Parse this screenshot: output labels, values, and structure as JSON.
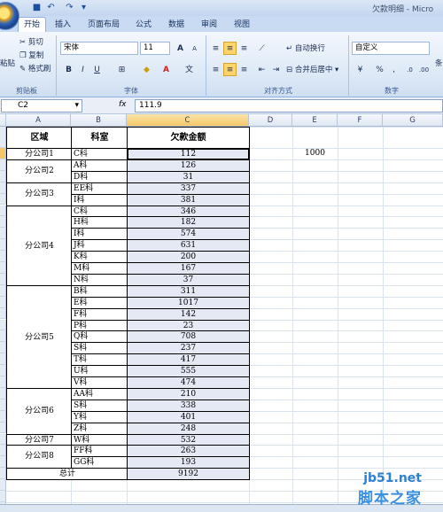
{
  "window": {
    "title": "欠款明细 - Micro"
  },
  "tabs": [
    "开始",
    "插入",
    "页面布局",
    "公式",
    "数据",
    "审阅",
    "视图"
  ],
  "ribbon": {
    "clipboard": {
      "paste": "粘贴",
      "cut": "剪切",
      "copy": "复制",
      "format_painter": "格式刷",
      "label": "剪贴板"
    },
    "font": {
      "name": "宋体",
      "size": "11",
      "grow": "A",
      "shrink": "A",
      "bold": "B",
      "italic": "I",
      "underline": "U",
      "label": "字体"
    },
    "alignment": {
      "wrap_text": "自动换行",
      "merge_center": "合并后居中",
      "label": "对齐方式"
    },
    "number": {
      "format": "自定义",
      "percent": "%",
      "comma": ",",
      "inc_dec": ".0",
      "dec_dec": ".00",
      "label": "数字"
    },
    "cut_off": "条"
  },
  "formula_bar": {
    "name_box": "C2",
    "fx": "fx",
    "formula": "111.9"
  },
  "columns": [
    "A",
    "B",
    "C",
    "D",
    "E",
    "F",
    "G"
  ],
  "table": {
    "headers": {
      "region": "区域",
      "dept": "科室",
      "amount": "欠款金额"
    },
    "groups": [
      {
        "region": "分公司1",
        "rows": [
          {
            "dept": "C科",
            "amount": "112"
          }
        ]
      },
      {
        "region": "分公司2",
        "rows": [
          {
            "dept": "A科",
            "amount": "126"
          },
          {
            "dept": "D科",
            "amount": "31"
          }
        ]
      },
      {
        "region": "分公司3",
        "rows": [
          {
            "dept": "EE科",
            "amount": "337"
          },
          {
            "dept": "I科",
            "amount": "381"
          }
        ]
      },
      {
        "region": "分公司4",
        "rows": [
          {
            "dept": "C科",
            "amount": "346"
          },
          {
            "dept": "H科",
            "amount": "182"
          },
          {
            "dept": "I科",
            "amount": "574"
          },
          {
            "dept": "J科",
            "amount": "631"
          },
          {
            "dept": "K科",
            "amount": "200"
          },
          {
            "dept": "M科",
            "amount": "167"
          },
          {
            "dept": "N科",
            "amount": "37"
          }
        ]
      },
      {
        "region": "分公司5",
        "rows": [
          {
            "dept": "B科",
            "amount": "311"
          },
          {
            "dept": "E科",
            "amount": "1017"
          },
          {
            "dept": "F科",
            "amount": "142"
          },
          {
            "dept": "P科",
            "amount": "23"
          },
          {
            "dept": "Q科",
            "amount": "708"
          },
          {
            "dept": "S科",
            "amount": "237"
          },
          {
            "dept": "T科",
            "amount": "417"
          },
          {
            "dept": "U科",
            "amount": "555"
          },
          {
            "dept": "V科",
            "amount": "474"
          }
        ]
      },
      {
        "region": "分公司6",
        "rows": [
          {
            "dept": "AA科",
            "amount": "210"
          },
          {
            "dept": "S科",
            "amount": "338"
          },
          {
            "dept": "Y科",
            "amount": "401"
          },
          {
            "dept": "Z科",
            "amount": "248"
          }
        ]
      },
      {
        "region": "分公司7",
        "rows": [
          {
            "dept": "W科",
            "amount": "532"
          }
        ]
      },
      {
        "region": "分公司8",
        "rows": [
          {
            "dept": "FF科",
            "amount": "263"
          },
          {
            "dept": "GG科",
            "amount": "193"
          }
        ]
      }
    ],
    "total_label": "总计",
    "total": "9192"
  },
  "extra_cell": {
    "column": "E",
    "value": "1000"
  },
  "watermark": {
    "site": "jb51.net",
    "name": "脚本之家"
  }
}
